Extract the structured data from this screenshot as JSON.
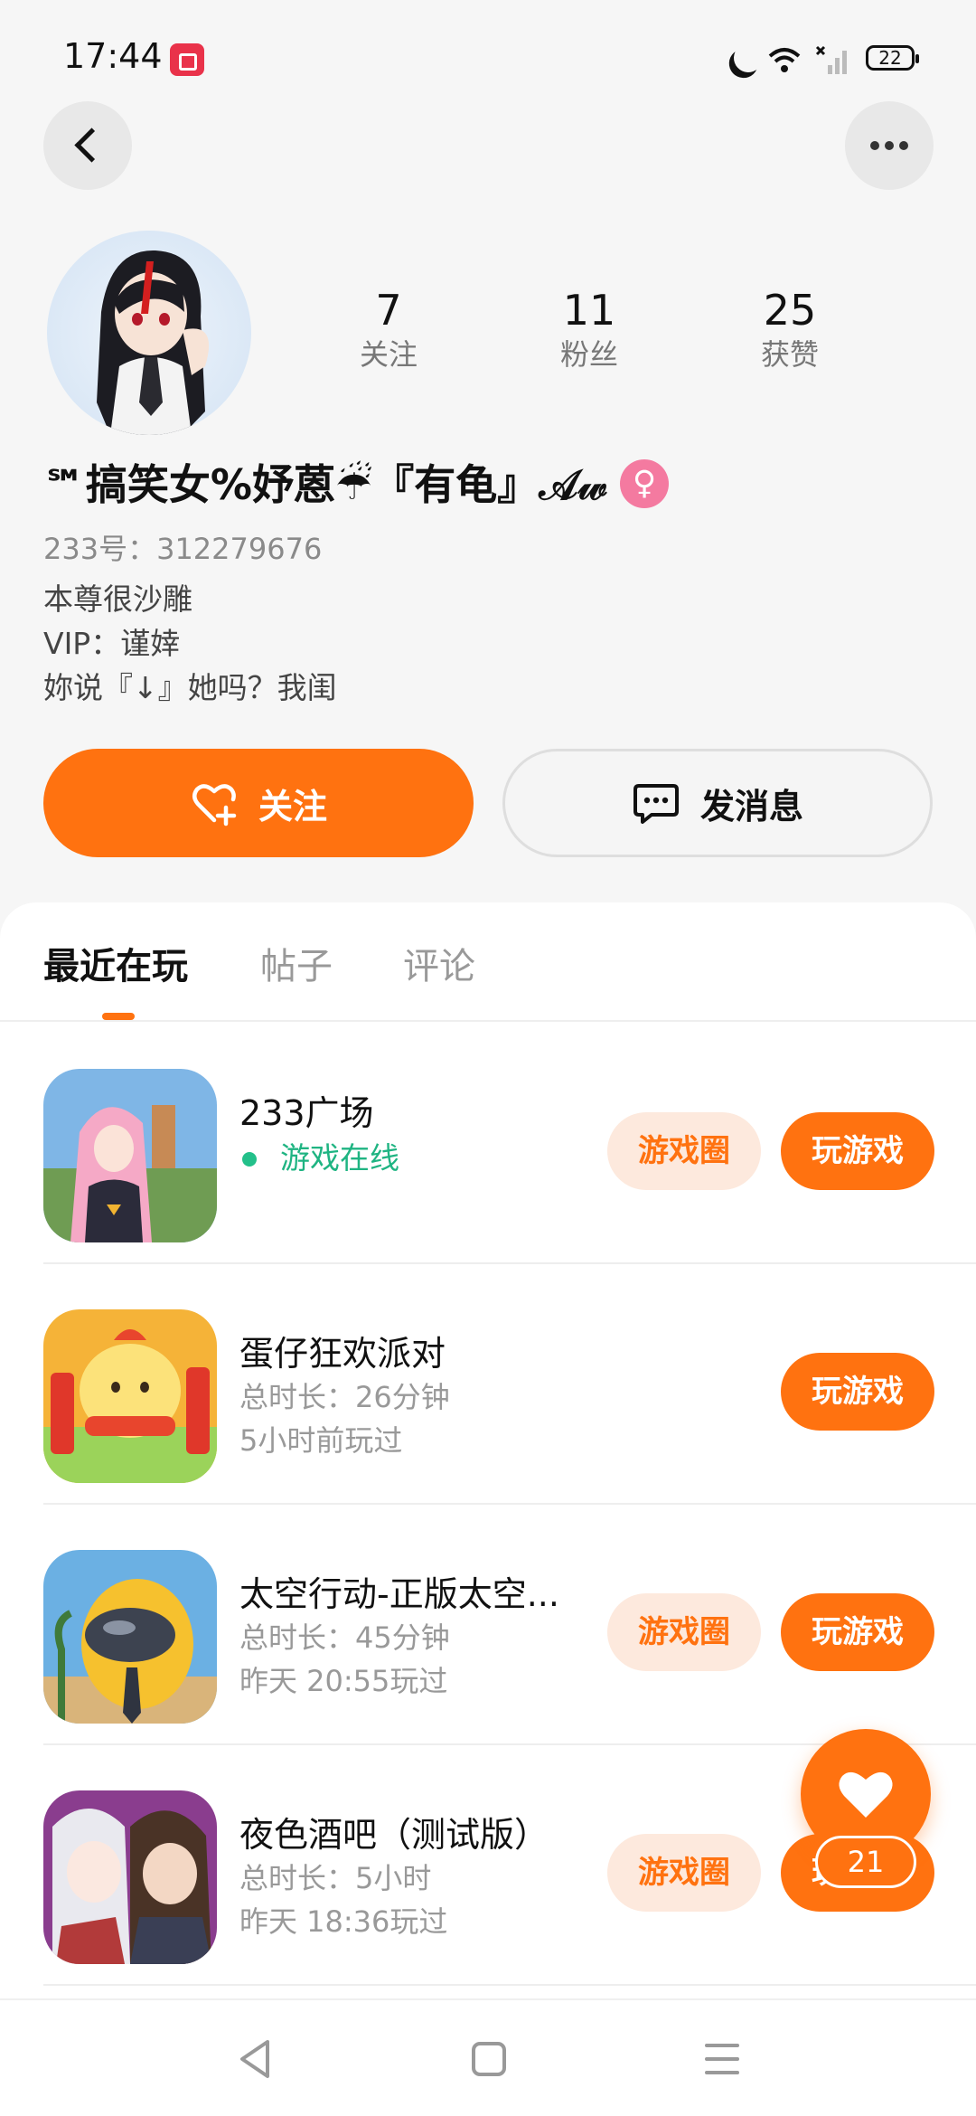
{
  "status_bar": {
    "time": "17:44",
    "battery": "22"
  },
  "profile": {
    "stats": [
      {
        "value": "7",
        "label": "关注"
      },
      {
        "value": "11",
        "label": "粉丝"
      },
      {
        "value": "25",
        "label": "获赞"
      }
    ],
    "nickname": "℠搞笑女%妤蒽☔『有龟』𝒜𝓌",
    "gender_symbol": "♀",
    "uid": "233号：312279676",
    "bio_lines": [
      "本尊很沙雕",
      "VIP：谨婞",
      "妳说『↓』她吗？我闺"
    ]
  },
  "actions": {
    "follow_label": "关注",
    "message_label": "发消息"
  },
  "tabs": [
    {
      "label": "最近在玩",
      "active": true
    },
    {
      "label": "帖子",
      "active": false
    },
    {
      "label": "评论",
      "active": false
    }
  ],
  "games": [
    {
      "title": "233广场",
      "status": "游戏在线",
      "has_circle": true,
      "circle_label": "游戏圈",
      "play_label": "玩游戏"
    },
    {
      "title": "蛋仔狂欢派对",
      "line1": "总时长：26分钟",
      "line2": "5小时前玩过",
      "has_circle": false,
      "play_label": "玩游戏"
    },
    {
      "title": "太空行动-正版太空...",
      "line1": "总时长：45分钟",
      "line2": "昨天 20:55玩过",
      "has_circle": true,
      "circle_label": "游戏圈",
      "play_label": "玩游戏"
    },
    {
      "title": "夜色酒吧（测试版）",
      "line1": "总时长：5小时",
      "line2": "昨天 18:36玩过",
      "has_circle": true,
      "circle_label": "游戏圈",
      "play_label": "玩游戏"
    }
  ],
  "float_like": {
    "count": "21"
  },
  "colors": {
    "accent": "#ff7210",
    "accent_light": "#fde9dd",
    "online": "#1fb482",
    "gender": "#f47aa0"
  }
}
